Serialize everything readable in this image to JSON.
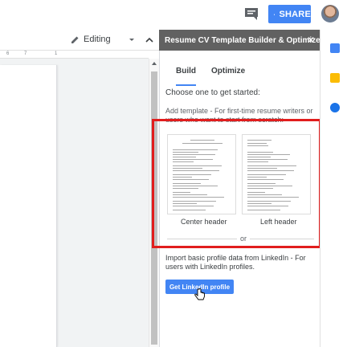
{
  "topbar": {
    "share_label": "SHARE",
    "comment_icon": "comment-icon",
    "lock_icon": "lock-icon"
  },
  "toolbar": {
    "mode_label": "Editing"
  },
  "ruler": {
    "ticks": [
      "6",
      "7",
      "1"
    ]
  },
  "sidebar": {
    "title": "Resume CV Template Builder & Optimizer",
    "close_label": "✕",
    "tabs": [
      {
        "label": "Build",
        "active": true
      },
      {
        "label": "Optimize",
        "active": false
      }
    ],
    "prompt": "Choose one to get started:",
    "add_template_text": "Add template - For first-time resume writers or users who want to start from scratch:",
    "templates": [
      {
        "label": "Center header"
      },
      {
        "label": "Left header"
      }
    ],
    "or_label": "or",
    "import_text": "Import basic profile data from LinkedIn - For users with LinkedIn profiles.",
    "linkedin_button_label": "Get LinkedIn profile"
  },
  "colors": {
    "accent": "#4285f4",
    "sidebar_header": "#616161",
    "highlight": "#e11d1d"
  }
}
